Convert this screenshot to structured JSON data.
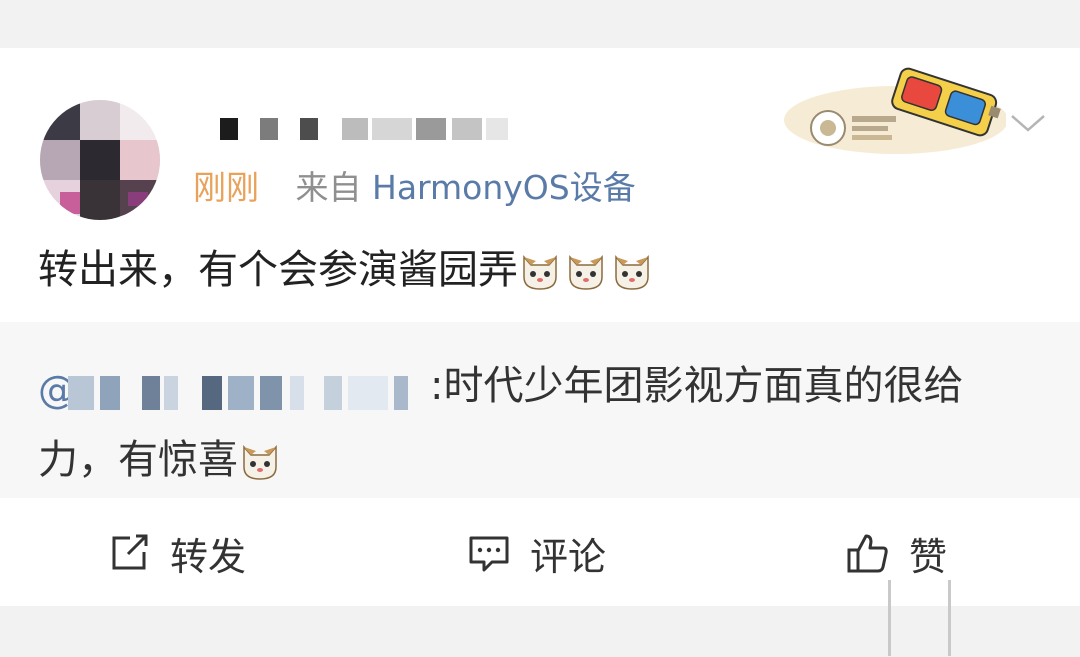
{
  "post": {
    "time": "刚刚",
    "source_prefix": "来自",
    "device": "HarmonyOS设备",
    "text": "转出来，有个会参演酱园弄",
    "emoji_count": 3
  },
  "repost": {
    "at_sign": "@",
    "text_line1": ":时代少年团影视方面真的很给",
    "text_line2": "力，有惊喜"
  },
  "actions": {
    "share_label": "转发",
    "comment_label": "评论",
    "like_label": "赞"
  },
  "icons": {
    "share": "share-icon",
    "comment": "comment-icon",
    "like": "thumbs-up-icon",
    "more": "chevron-down-icon",
    "badge": "3d-glasses-badge-icon",
    "emoji": "cat-face-emoji"
  },
  "colors": {
    "time": "#e8a25a",
    "device_link": "#5a7ba8",
    "mention": "#5a7ba8",
    "card_bg": "#ffffff",
    "repost_bg": "#f7f7f7"
  }
}
